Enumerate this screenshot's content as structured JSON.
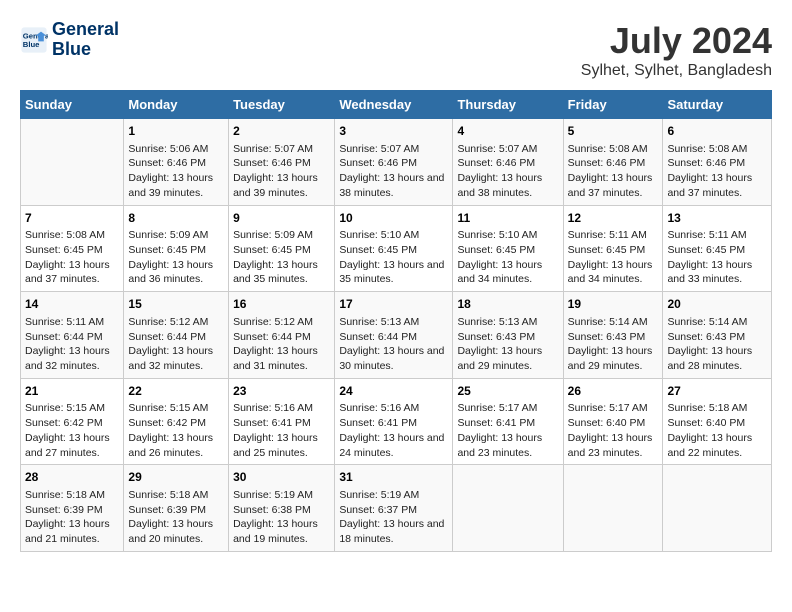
{
  "logo": {
    "line1": "General",
    "line2": "Blue"
  },
  "title": "July 2024",
  "subtitle": "Sylhet, Sylhet, Bangladesh",
  "headers": [
    "Sunday",
    "Monday",
    "Tuesday",
    "Wednesday",
    "Thursday",
    "Friday",
    "Saturday"
  ],
  "weeks": [
    [
      {
        "day": "",
        "sunrise": "",
        "sunset": "",
        "daylight": ""
      },
      {
        "day": "1",
        "sunrise": "Sunrise: 5:06 AM",
        "sunset": "Sunset: 6:46 PM",
        "daylight": "Daylight: 13 hours and 39 minutes."
      },
      {
        "day": "2",
        "sunrise": "Sunrise: 5:07 AM",
        "sunset": "Sunset: 6:46 PM",
        "daylight": "Daylight: 13 hours and 39 minutes."
      },
      {
        "day": "3",
        "sunrise": "Sunrise: 5:07 AM",
        "sunset": "Sunset: 6:46 PM",
        "daylight": "Daylight: 13 hours and 38 minutes."
      },
      {
        "day": "4",
        "sunrise": "Sunrise: 5:07 AM",
        "sunset": "Sunset: 6:46 PM",
        "daylight": "Daylight: 13 hours and 38 minutes."
      },
      {
        "day": "5",
        "sunrise": "Sunrise: 5:08 AM",
        "sunset": "Sunset: 6:46 PM",
        "daylight": "Daylight: 13 hours and 37 minutes."
      },
      {
        "day": "6",
        "sunrise": "Sunrise: 5:08 AM",
        "sunset": "Sunset: 6:46 PM",
        "daylight": "Daylight: 13 hours and 37 minutes."
      }
    ],
    [
      {
        "day": "7",
        "sunrise": "Sunrise: 5:08 AM",
        "sunset": "Sunset: 6:45 PM",
        "daylight": "Daylight: 13 hours and 37 minutes."
      },
      {
        "day": "8",
        "sunrise": "Sunrise: 5:09 AM",
        "sunset": "Sunset: 6:45 PM",
        "daylight": "Daylight: 13 hours and 36 minutes."
      },
      {
        "day": "9",
        "sunrise": "Sunrise: 5:09 AM",
        "sunset": "Sunset: 6:45 PM",
        "daylight": "Daylight: 13 hours and 35 minutes."
      },
      {
        "day": "10",
        "sunrise": "Sunrise: 5:10 AM",
        "sunset": "Sunset: 6:45 PM",
        "daylight": "Daylight: 13 hours and 35 minutes."
      },
      {
        "day": "11",
        "sunrise": "Sunrise: 5:10 AM",
        "sunset": "Sunset: 6:45 PM",
        "daylight": "Daylight: 13 hours and 34 minutes."
      },
      {
        "day": "12",
        "sunrise": "Sunrise: 5:11 AM",
        "sunset": "Sunset: 6:45 PM",
        "daylight": "Daylight: 13 hours and 34 minutes."
      },
      {
        "day": "13",
        "sunrise": "Sunrise: 5:11 AM",
        "sunset": "Sunset: 6:45 PM",
        "daylight": "Daylight: 13 hours and 33 minutes."
      }
    ],
    [
      {
        "day": "14",
        "sunrise": "Sunrise: 5:11 AM",
        "sunset": "Sunset: 6:44 PM",
        "daylight": "Daylight: 13 hours and 32 minutes."
      },
      {
        "day": "15",
        "sunrise": "Sunrise: 5:12 AM",
        "sunset": "Sunset: 6:44 PM",
        "daylight": "Daylight: 13 hours and 32 minutes."
      },
      {
        "day": "16",
        "sunrise": "Sunrise: 5:12 AM",
        "sunset": "Sunset: 6:44 PM",
        "daylight": "Daylight: 13 hours and 31 minutes."
      },
      {
        "day": "17",
        "sunrise": "Sunrise: 5:13 AM",
        "sunset": "Sunset: 6:44 PM",
        "daylight": "Daylight: 13 hours and 30 minutes."
      },
      {
        "day": "18",
        "sunrise": "Sunrise: 5:13 AM",
        "sunset": "Sunset: 6:43 PM",
        "daylight": "Daylight: 13 hours and 29 minutes."
      },
      {
        "day": "19",
        "sunrise": "Sunrise: 5:14 AM",
        "sunset": "Sunset: 6:43 PM",
        "daylight": "Daylight: 13 hours and 29 minutes."
      },
      {
        "day": "20",
        "sunrise": "Sunrise: 5:14 AM",
        "sunset": "Sunset: 6:43 PM",
        "daylight": "Daylight: 13 hours and 28 minutes."
      }
    ],
    [
      {
        "day": "21",
        "sunrise": "Sunrise: 5:15 AM",
        "sunset": "Sunset: 6:42 PM",
        "daylight": "Daylight: 13 hours and 27 minutes."
      },
      {
        "day": "22",
        "sunrise": "Sunrise: 5:15 AM",
        "sunset": "Sunset: 6:42 PM",
        "daylight": "Daylight: 13 hours and 26 minutes."
      },
      {
        "day": "23",
        "sunrise": "Sunrise: 5:16 AM",
        "sunset": "Sunset: 6:41 PM",
        "daylight": "Daylight: 13 hours and 25 minutes."
      },
      {
        "day": "24",
        "sunrise": "Sunrise: 5:16 AM",
        "sunset": "Sunset: 6:41 PM",
        "daylight": "Daylight: 13 hours and 24 minutes."
      },
      {
        "day": "25",
        "sunrise": "Sunrise: 5:17 AM",
        "sunset": "Sunset: 6:41 PM",
        "daylight": "Daylight: 13 hours and 23 minutes."
      },
      {
        "day": "26",
        "sunrise": "Sunrise: 5:17 AM",
        "sunset": "Sunset: 6:40 PM",
        "daylight": "Daylight: 13 hours and 23 minutes."
      },
      {
        "day": "27",
        "sunrise": "Sunrise: 5:18 AM",
        "sunset": "Sunset: 6:40 PM",
        "daylight": "Daylight: 13 hours and 22 minutes."
      }
    ],
    [
      {
        "day": "28",
        "sunrise": "Sunrise: 5:18 AM",
        "sunset": "Sunset: 6:39 PM",
        "daylight": "Daylight: 13 hours and 21 minutes."
      },
      {
        "day": "29",
        "sunrise": "Sunrise: 5:18 AM",
        "sunset": "Sunset: 6:39 PM",
        "daylight": "Daylight: 13 hours and 20 minutes."
      },
      {
        "day": "30",
        "sunrise": "Sunrise: 5:19 AM",
        "sunset": "Sunset: 6:38 PM",
        "daylight": "Daylight: 13 hours and 19 minutes."
      },
      {
        "day": "31",
        "sunrise": "Sunrise: 5:19 AM",
        "sunset": "Sunset: 6:37 PM",
        "daylight": "Daylight: 13 hours and 18 minutes."
      },
      {
        "day": "",
        "sunrise": "",
        "sunset": "",
        "daylight": ""
      },
      {
        "day": "",
        "sunrise": "",
        "sunset": "",
        "daylight": ""
      },
      {
        "day": "",
        "sunrise": "",
        "sunset": "",
        "daylight": ""
      }
    ]
  ]
}
